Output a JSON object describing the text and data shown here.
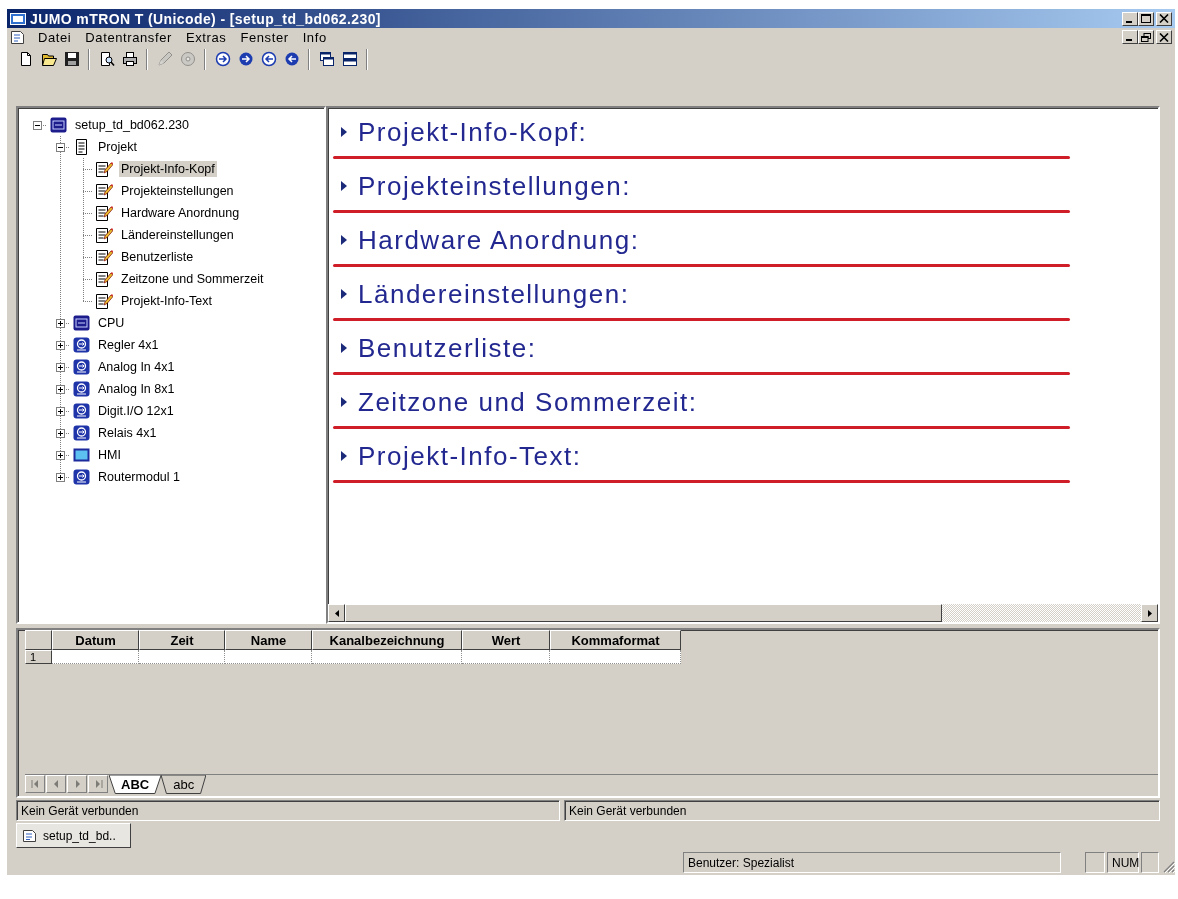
{
  "window": {
    "title": "JUMO mTRON T (Unicode) - [setup_td_bd062.230]"
  },
  "menu": [
    "Datei",
    "Datentransfer",
    "Extras",
    "Fenster",
    "Info"
  ],
  "toolbar": [
    [
      {
        "disabled": false
      },
      {
        "disabled": false
      },
      {
        "disabled": false
      }
    ],
    [
      {
        "disabled": false
      },
      {
        "disabled": false
      }
    ],
    [
      {
        "disabled": true
      },
      {
        "disabled": true
      }
    ],
    [
      {
        "disabled": false
      },
      {
        "disabled": false
      },
      {
        "disabled": false
      },
      {
        "disabled": false
      }
    ],
    [
      {
        "disabled": false
      },
      {
        "disabled": false
      }
    ]
  ],
  "tree": [
    {
      "label": "setup_td_bd062.230",
      "kind": "chip",
      "expanded": true,
      "selected": false,
      "children": [
        {
          "label": "Projekt",
          "kind": "document",
          "expanded": true,
          "selected": false,
          "children": [
            {
              "label": "Projekt-Info-Kopf",
              "kind": "page",
              "selected": true
            },
            {
              "label": "Projekteinstellungen",
              "kind": "page",
              "selected": false
            },
            {
              "label": "Hardware Anordnung",
              "kind": "page",
              "selected": false
            },
            {
              "label": "Ländereinstellungen",
              "kind": "page",
              "selected": false
            },
            {
              "label": "Benutzerliste",
              "kind": "page",
              "selected": false
            },
            {
              "label": "Zeitzone und Sommerzeit",
              "kind": "page",
              "selected": false
            },
            {
              "label": "Projekt-Info-Text",
              "kind": "page",
              "selected": false
            }
          ]
        },
        {
          "label": "CPU",
          "kind": "chip",
          "expanded": false,
          "selected": false
        },
        {
          "label": "Regler 4x1",
          "kind": "module",
          "expanded": false,
          "selected": false
        },
        {
          "label": "Analog In 4x1",
          "kind": "module",
          "expanded": false,
          "selected": false
        },
        {
          "label": "Analog In 8x1",
          "kind": "module",
          "expanded": false,
          "selected": false
        },
        {
          "label": "Digit.I/O 12x1",
          "kind": "module",
          "expanded": false,
          "selected": false
        },
        {
          "label": "Relais 4x1",
          "kind": "module",
          "expanded": false,
          "selected": false
        },
        {
          "label": "HMI",
          "kind": "screen",
          "expanded": false,
          "selected": false
        },
        {
          "label": "Routermodul 1",
          "kind": "module",
          "expanded": false,
          "selected": false
        }
      ]
    }
  ],
  "sections": [
    {
      "title": "Projekt-Info-Kopf:"
    },
    {
      "title": "Projekteinstellungen:"
    },
    {
      "title": "Hardware Anordnung:"
    },
    {
      "title": "Ländereinstellungen:"
    },
    {
      "title": "Benutzerliste:"
    },
    {
      "title": "Zeitzone und Sommerzeit:"
    },
    {
      "title": "Projekt-Info-Text:"
    }
  ],
  "table": {
    "columns": [
      "Datum",
      "Zeit",
      "Name",
      "Kanalbezeichnung",
      "Wert",
      "Kommaformat"
    ],
    "rows": [
      {
        "number": "1"
      }
    ]
  },
  "sheet_tabs": {
    "navigation": [
      {
        "disabled": true
      },
      {
        "disabled": true
      },
      {
        "disabled": true
      },
      {
        "disabled": true
      }
    ],
    "tabs": [
      {
        "label": "ABC",
        "selected": true
      },
      {
        "label": "abc",
        "selected": false
      }
    ]
  },
  "messages": [
    "Kein Gerät verbunden",
    "Kein Gerät verbunden"
  ],
  "document_tabs": [
    {
      "label": "setup_td_bd..",
      "selected": true
    }
  ],
  "status_bar": {
    "user": "Benutzer: Spezialist",
    "indicator": "NUM"
  }
}
